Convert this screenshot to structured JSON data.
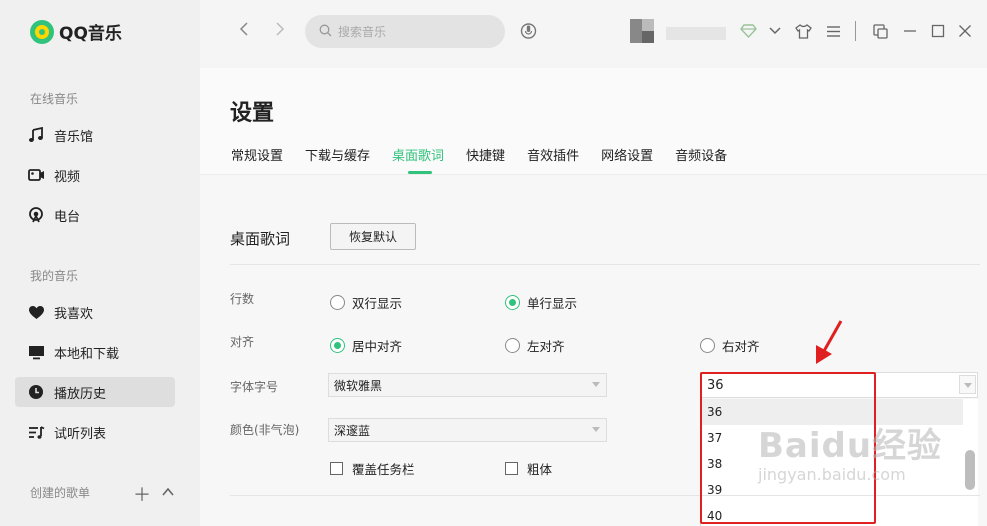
{
  "app": {
    "name": "QQ音乐",
    "brand_color": "#31c27c"
  },
  "sidebar": {
    "online_title": "在线音乐",
    "online_items": [
      {
        "label": "音乐馆",
        "icon": "music-note-icon"
      },
      {
        "label": "视频",
        "icon": "video-icon"
      },
      {
        "label": "电台",
        "icon": "radio-icon"
      }
    ],
    "mine_title": "我的音乐",
    "mine_items": [
      {
        "label": "我喜欢",
        "icon": "heart-icon"
      },
      {
        "label": "本地和下载",
        "icon": "monitor-icon"
      },
      {
        "label": "播放历史",
        "icon": "clock-icon",
        "active": true
      },
      {
        "label": "试听列表",
        "icon": "playlist-icon"
      }
    ],
    "created_title": "创建的歌单"
  },
  "topbar": {
    "search_placeholder": "搜索音乐",
    "icons": [
      "back-icon",
      "forward-icon",
      "search-icon",
      "mic-icon",
      "diamond-icon",
      "chevron-down-icon",
      "tshirt-icon",
      "menu-icon",
      "mini-mode-icon",
      "minimize-icon",
      "maximize-icon",
      "close-icon"
    ]
  },
  "page": {
    "title": "设置",
    "tabs": [
      "常规设置",
      "下载与缓存",
      "桌面歌词",
      "快捷键",
      "音效插件",
      "网络设置",
      "音频设备"
    ],
    "active_tab": "桌面歌词"
  },
  "lyrics": {
    "section_title": "桌面歌词",
    "restore_button": "恢复默认",
    "rows_label": "行数",
    "rows_options": [
      {
        "label": "双行显示",
        "checked": false
      },
      {
        "label": "单行显示",
        "checked": true
      }
    ],
    "align_label": "对齐",
    "align_options": [
      {
        "label": "居中对齐",
        "checked": true
      },
      {
        "label": "左对齐",
        "checked": false
      },
      {
        "label": "右对齐",
        "checked": false
      }
    ],
    "font_label": "字体字号",
    "font_value": "微软雅黑",
    "size_value": "36",
    "size_options": [
      "36",
      "37",
      "38",
      "39",
      "40"
    ],
    "color_label": "颜色(非气泡)",
    "color_value": "深邃蓝",
    "cover_taskbar": "覆盖任务栏",
    "bold": "粗体"
  },
  "annotation": {
    "color": "#e02020"
  },
  "watermark": {
    "main": "Baidu经验",
    "sub": "jingyan.baidu.com"
  }
}
